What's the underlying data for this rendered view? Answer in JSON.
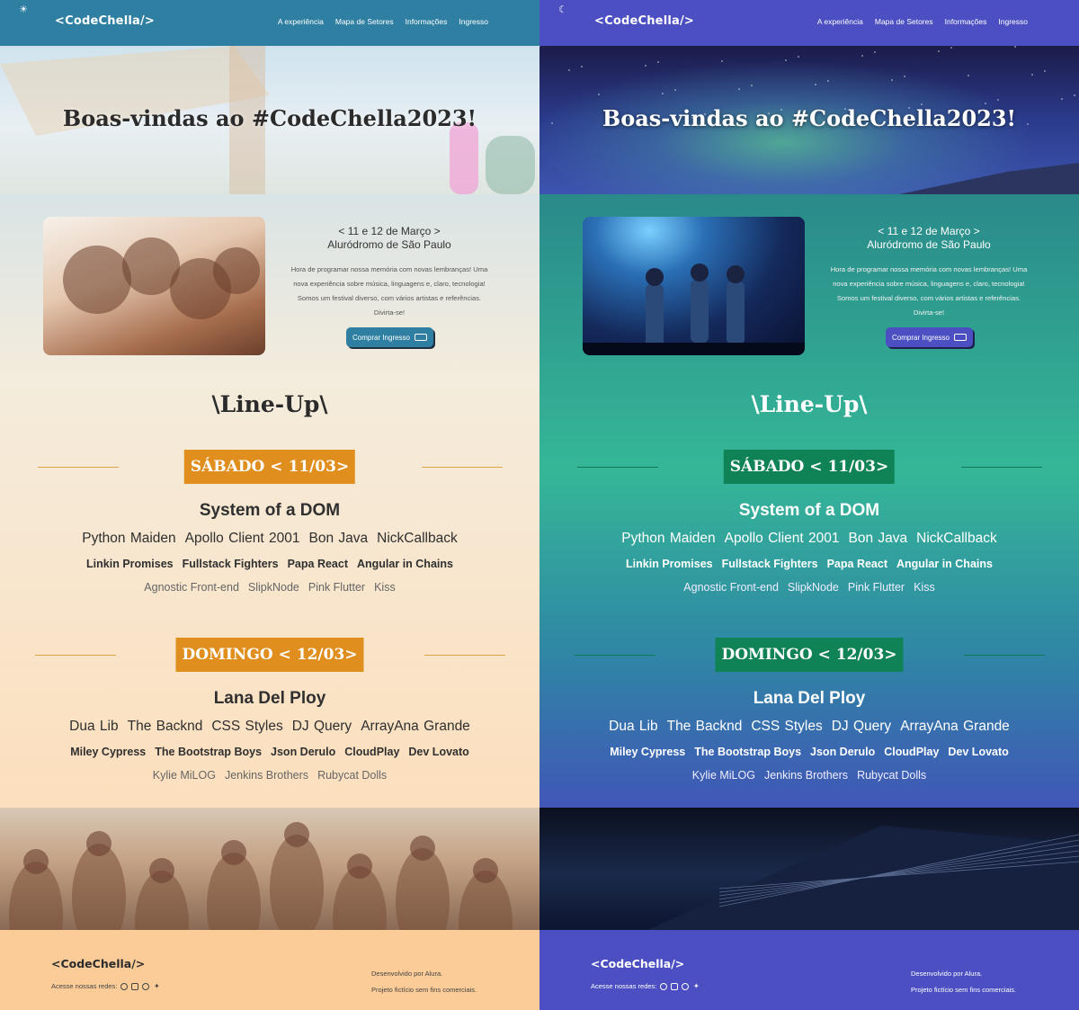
{
  "panels": {
    "light": {
      "theme_icon": "☀",
      "theme_icon_name": "sun-icon",
      "accent": "#2e7fa1",
      "badge_color": "#e08e1d"
    },
    "dark": {
      "theme_icon": "☾",
      "theme_icon_name": "moon-icon",
      "accent": "#4b4fc2",
      "badge_color": "#108356"
    }
  },
  "header": {
    "logo": "<CodeChella/>",
    "nav": [
      "A experiência",
      "Mapa de Setores",
      "Informações",
      "Ingresso"
    ]
  },
  "hero": {
    "title": "Boas-vindas ao #CodeChella2023!"
  },
  "intro": {
    "dates": "< 11 e 12 de Março >",
    "venue": "Aluródromo de São Paulo",
    "description": "Hora de programar nossa memória com novas lembranças! Uma nova experiência sobre música, linguagens e, claro, tecnologia! Somos um festival diverso, com vários artistas e referências. Divirta-se!",
    "buy_label": "Comprar Ingresso",
    "buy_icon": "ticket-icon"
  },
  "lineup": {
    "title": "\\Line-Up\\",
    "days": [
      {
        "label": "SÁBADO < 11/03>",
        "headliner": "System of a DOM",
        "tier1": [
          "Python Maiden",
          "Apollo Client 2001",
          "Bon Java",
          "NickCallback"
        ],
        "tier2": [
          "Linkin Promises",
          "Fullstack Fighters",
          "Papa React",
          "Angular in Chains"
        ],
        "tier3": [
          "Agnostic Front-end",
          "SlipkNode",
          "Pink Flutter",
          "Kiss"
        ]
      },
      {
        "label": "DOMINGO < 12/03>",
        "headliner": "Lana Del Ploy",
        "tier1": [
          "Dua Lib",
          "The Backnd",
          "CSS Styles",
          "DJ Query",
          "ArrayAna Grande"
        ],
        "tier2": [
          "Miley Cypress",
          "The Bootstrap Boys",
          "Json Derulo",
          "CloudPlay",
          "Dev Lovato"
        ],
        "tier3": [
          "Kylie MiLOG",
          "Jenkins Brothers",
          "Rubycat Dolls"
        ]
      }
    ]
  },
  "footer": {
    "logo": "<CodeChella/>",
    "socials_label": "Acesse nossas redes:",
    "social_icons": [
      "whatsapp-icon",
      "twitch-icon",
      "instagram-icon",
      "twitter-icon"
    ],
    "credit_1": "Desenvolvido por Alura.",
    "credit_2": "Projeto fictício sem fins comerciais."
  }
}
